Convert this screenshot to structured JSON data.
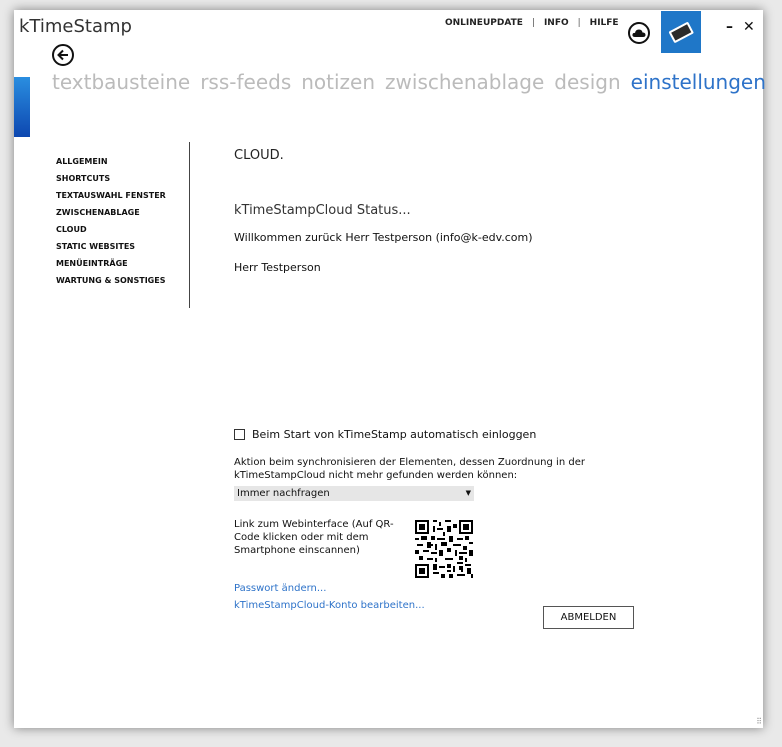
{
  "app": {
    "title": "kTimeStamp"
  },
  "top_links": [
    {
      "label": "ONLINEUPDATE"
    },
    {
      "label": "INFO"
    },
    {
      "label": "HILFE"
    }
  ],
  "top_link_separator": "|",
  "window_controls": {
    "minimize": "–",
    "close": "✕"
  },
  "nav_tabs": [
    {
      "label": "textbausteine"
    },
    {
      "label": "rss-feeds"
    },
    {
      "label": "notizen"
    },
    {
      "label": "zwischenablage"
    },
    {
      "label": "design"
    },
    {
      "label": "einstellungen",
      "active": true
    }
  ],
  "sidebar": {
    "items": [
      {
        "label": "ALLGEMEIN"
      },
      {
        "label": "SHORTCUTS"
      },
      {
        "label": "TEXTAUSWAHL FENSTER"
      },
      {
        "label": "ZWISCHENABLAGE"
      },
      {
        "label": "CLOUD",
        "active": true
      },
      {
        "label": "STATIC WEBSITES"
      },
      {
        "label": "MENÜEINTRÄGE"
      },
      {
        "label": "WARTUNG & SONSTIGES"
      }
    ]
  },
  "content": {
    "page_title": "CLOUD.",
    "status_heading": "kTimeStampCloud Status...",
    "welcome_text": "Willkommen zurück Herr Testperson (info@k-edv.com)",
    "user_name": "Herr Testperson",
    "auto_login_label": "Beim Start von kTimeStamp automatisch einloggen",
    "auto_login_checked": false,
    "sync_action_label": "Aktion beim synchronisieren der Elementen, dessen Zuordnung in der kTimeStampCloud nicht mehr gefunden werden können:",
    "sync_action_value": "Immer nachfragen",
    "web_interface_label": "Link zum Webinterface (Auf QR-Code klicken oder mit dem Smartphone einscannen)",
    "change_password_link": "Passwort ändern...",
    "edit_account_link": "kTimeStampCloud-Konto bearbeiten...",
    "logout_button": "ABMELDEN"
  },
  "colors": {
    "accent": "#2e73c9",
    "inactive_tab": "#bbbbbb",
    "tile": "#1f77c8"
  },
  "icons": {
    "cloud": "cloud-icon",
    "device": "tablet-icon",
    "back": "arrow-left-icon",
    "dropdown": "caret-down-icon",
    "qr": "qr-code-icon"
  }
}
